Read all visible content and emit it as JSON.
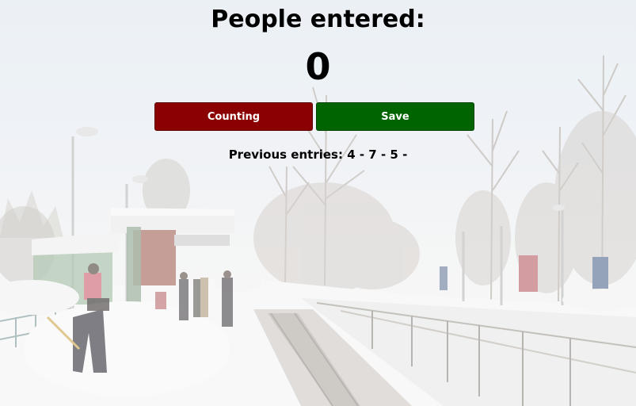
{
  "header": {
    "title": "People entered:"
  },
  "counter": {
    "value": "0"
  },
  "buttons": {
    "counting_label": "Counting",
    "save_label": "Save"
  },
  "previous": {
    "label": "Previous entries:",
    "entries": "4 - 7 - 5 -"
  },
  "colors": {
    "counting_button": "#8b0000",
    "save_button": "#006400",
    "text": "#000000"
  }
}
